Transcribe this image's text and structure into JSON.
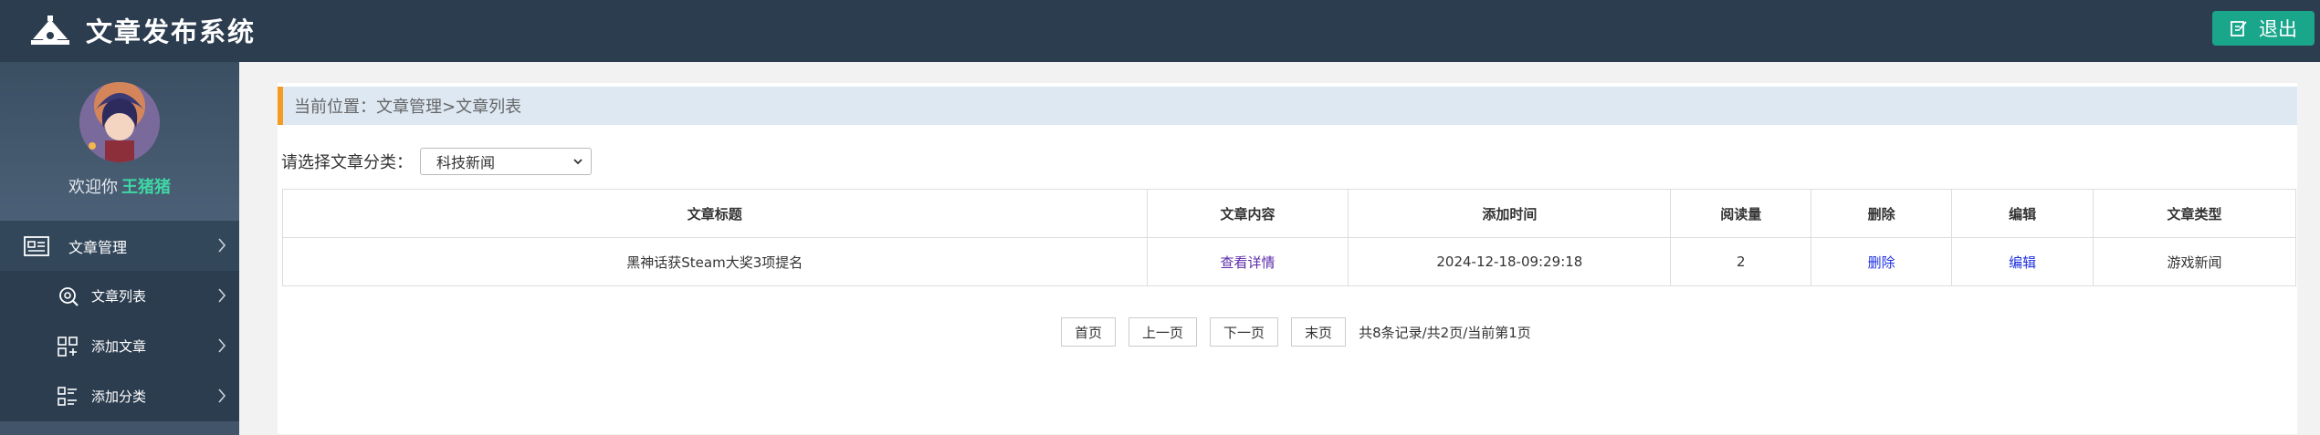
{
  "header": {
    "title": "文章发布系统",
    "logout_label": "退出",
    "colors": {
      "background": "#2c3d50",
      "logout": "#1aa68b"
    }
  },
  "sidebar": {
    "welcome_prefix": "欢迎你",
    "username": "王猪猪",
    "menu": [
      {
        "label": "文章管理",
        "icon": "article-manage-icon"
      },
      {
        "label": "文章列表",
        "icon": "search-list-icon"
      },
      {
        "label": "添加文章",
        "icon": "grid-add-icon"
      },
      {
        "label": "添加分类",
        "icon": "list-category-icon"
      }
    ]
  },
  "breadcrumb": {
    "text": "当前位置：文章管理>文章列表"
  },
  "filter": {
    "label": "请选择文章分类：",
    "selected": "科技新闻"
  },
  "table": {
    "headers": [
      "文章标题",
      "文章内容",
      "添加时间",
      "阅读量",
      "删除",
      "编辑",
      "文章类型"
    ],
    "rows": [
      {
        "title": "黑神话获Steam大奖3项提名",
        "content": "查看详情",
        "time": "2024-12-18-09:29:18",
        "reads": "2",
        "delete": "删除",
        "edit": "编辑",
        "type": "游戏新闻"
      }
    ]
  },
  "pager": {
    "first": "首页",
    "prev": "上一页",
    "next": "下一页",
    "last": "末页",
    "info": "共8条记录/共2页/当前第1页"
  }
}
